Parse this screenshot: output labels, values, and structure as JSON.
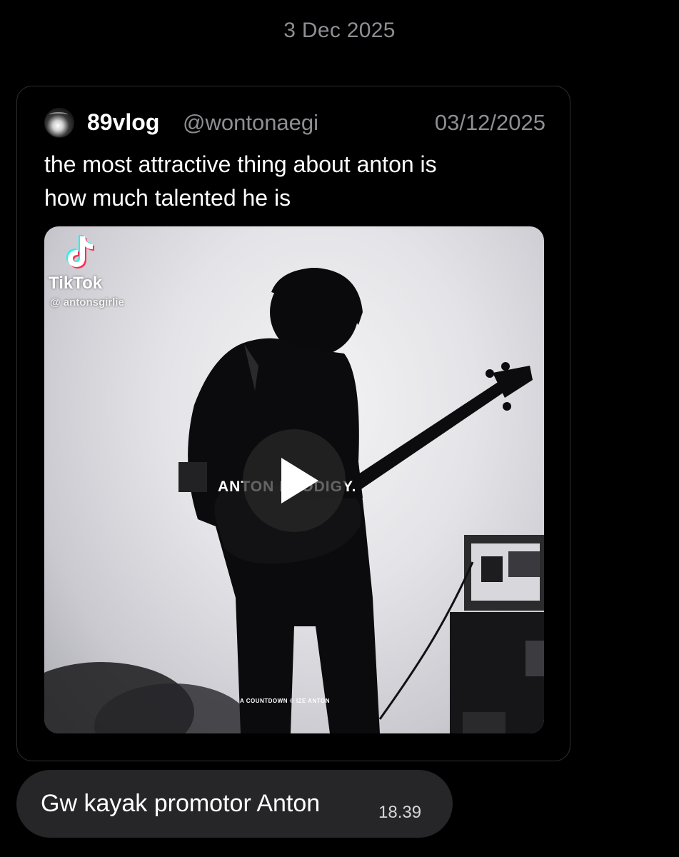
{
  "date_separator": "3 Dec 2025",
  "shared_post": {
    "display_name": "89vlog",
    "username": "@wontonaegi",
    "date": "03/12/2025",
    "text_line_1": "the most attractive thing about anton is",
    "text_line_2": "how much talented he is",
    "media": {
      "type": "video",
      "watermark_app": "TikTok",
      "watermark_handle": "@ antonsgirlie",
      "overlay_caption": "ANTON PRODIGY.",
      "bottom_caption": "A COUNTDOWN © IZE ANTON",
      "play_icon": "play-icon"
    }
  },
  "message": {
    "text": "Gw kayak promotor Anton",
    "time": "18.39"
  },
  "colors": {
    "background": "#000000",
    "muted_text": "#8e8e93",
    "bubble": "#262628",
    "card_border": "#2e2e30"
  }
}
